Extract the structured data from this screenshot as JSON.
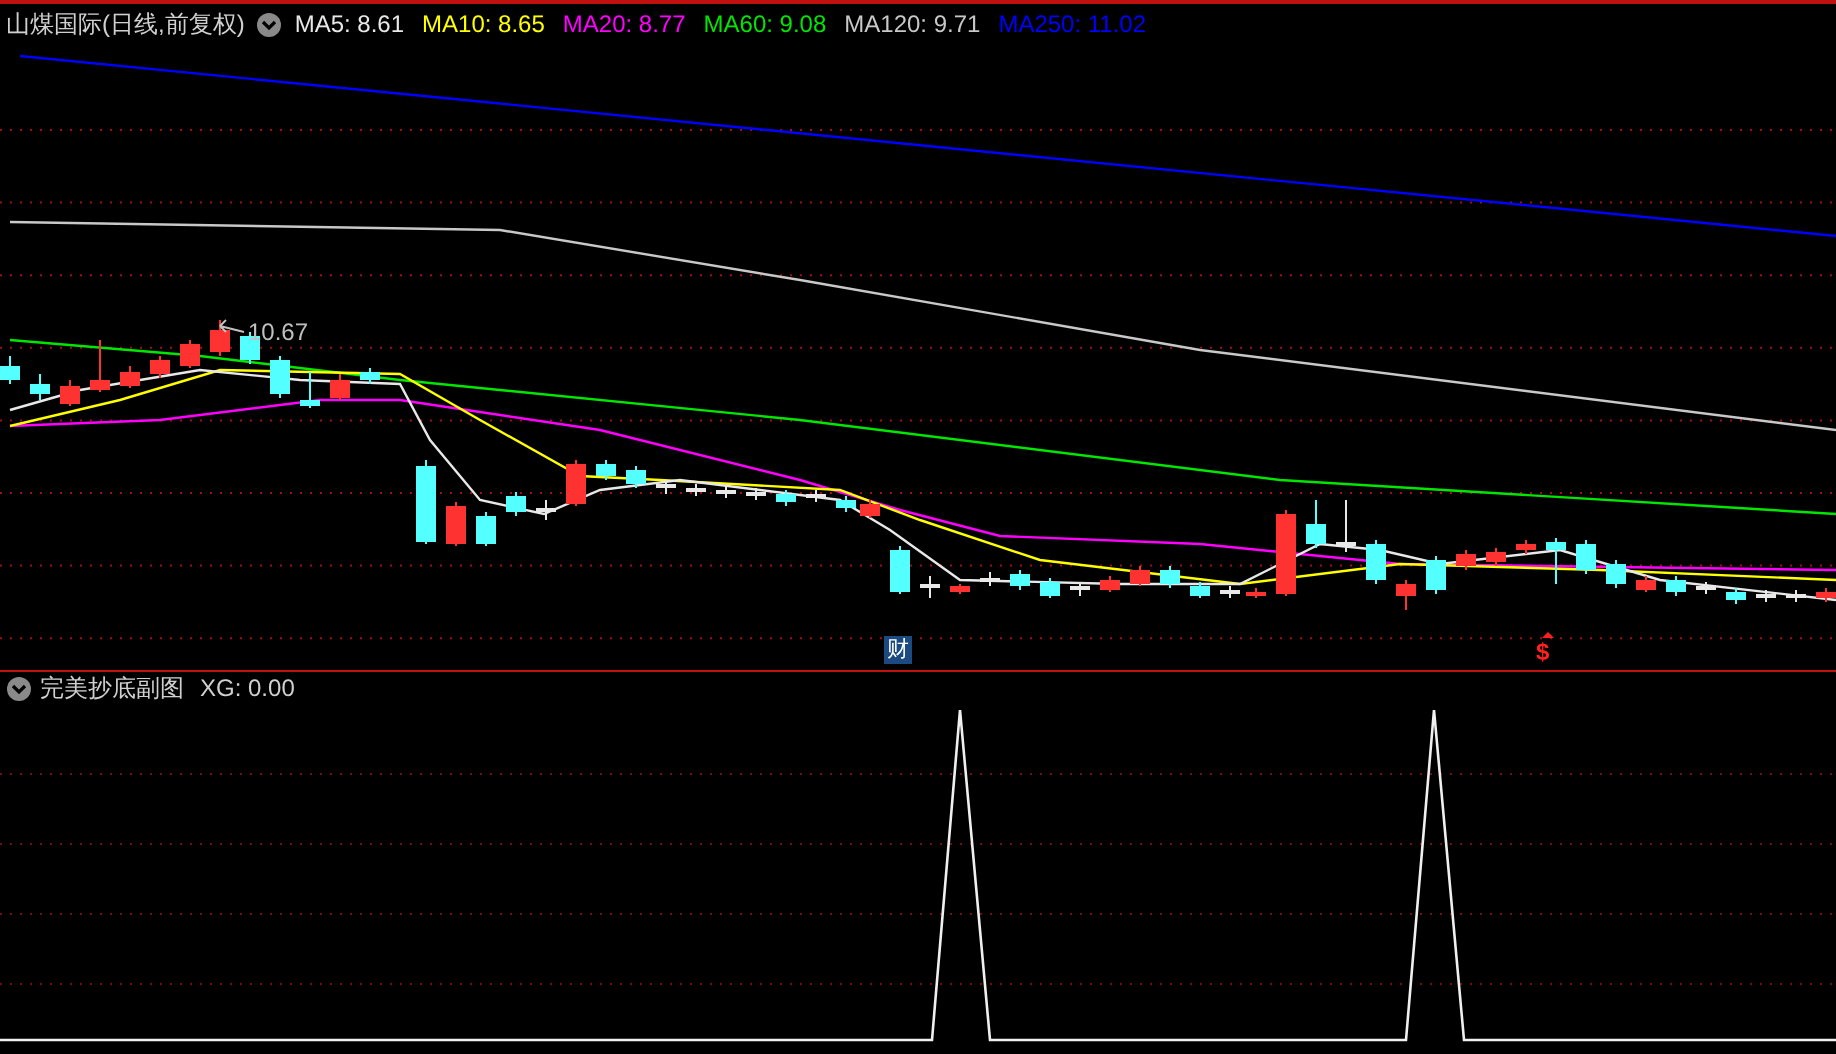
{
  "main_chart": {
    "title": "山煤国际(日线,前复权)",
    "indicators": [
      {
        "label": "MA5: 8.61",
        "color": "#e8e8e8"
      },
      {
        "label": "MA10: 8.65",
        "color": "#ffff00"
      },
      {
        "label": "MA20: 8.77",
        "color": "#ff00ff"
      },
      {
        "label": "MA60: 9.08",
        "color": "#00e600"
      },
      {
        "label": "MA120: 9.71",
        "color": "#c8c8c8"
      },
      {
        "label": "MA250: 11.02",
        "color": "#0000ff"
      }
    ],
    "high_label": "10.67",
    "markers": [
      {
        "kind": "finance",
        "text": "财"
      },
      {
        "kind": "dollar",
        "text": "$"
      }
    ]
  },
  "sub_chart": {
    "title": "完美抄底副图",
    "reading": "XG: 0.00"
  }
}
